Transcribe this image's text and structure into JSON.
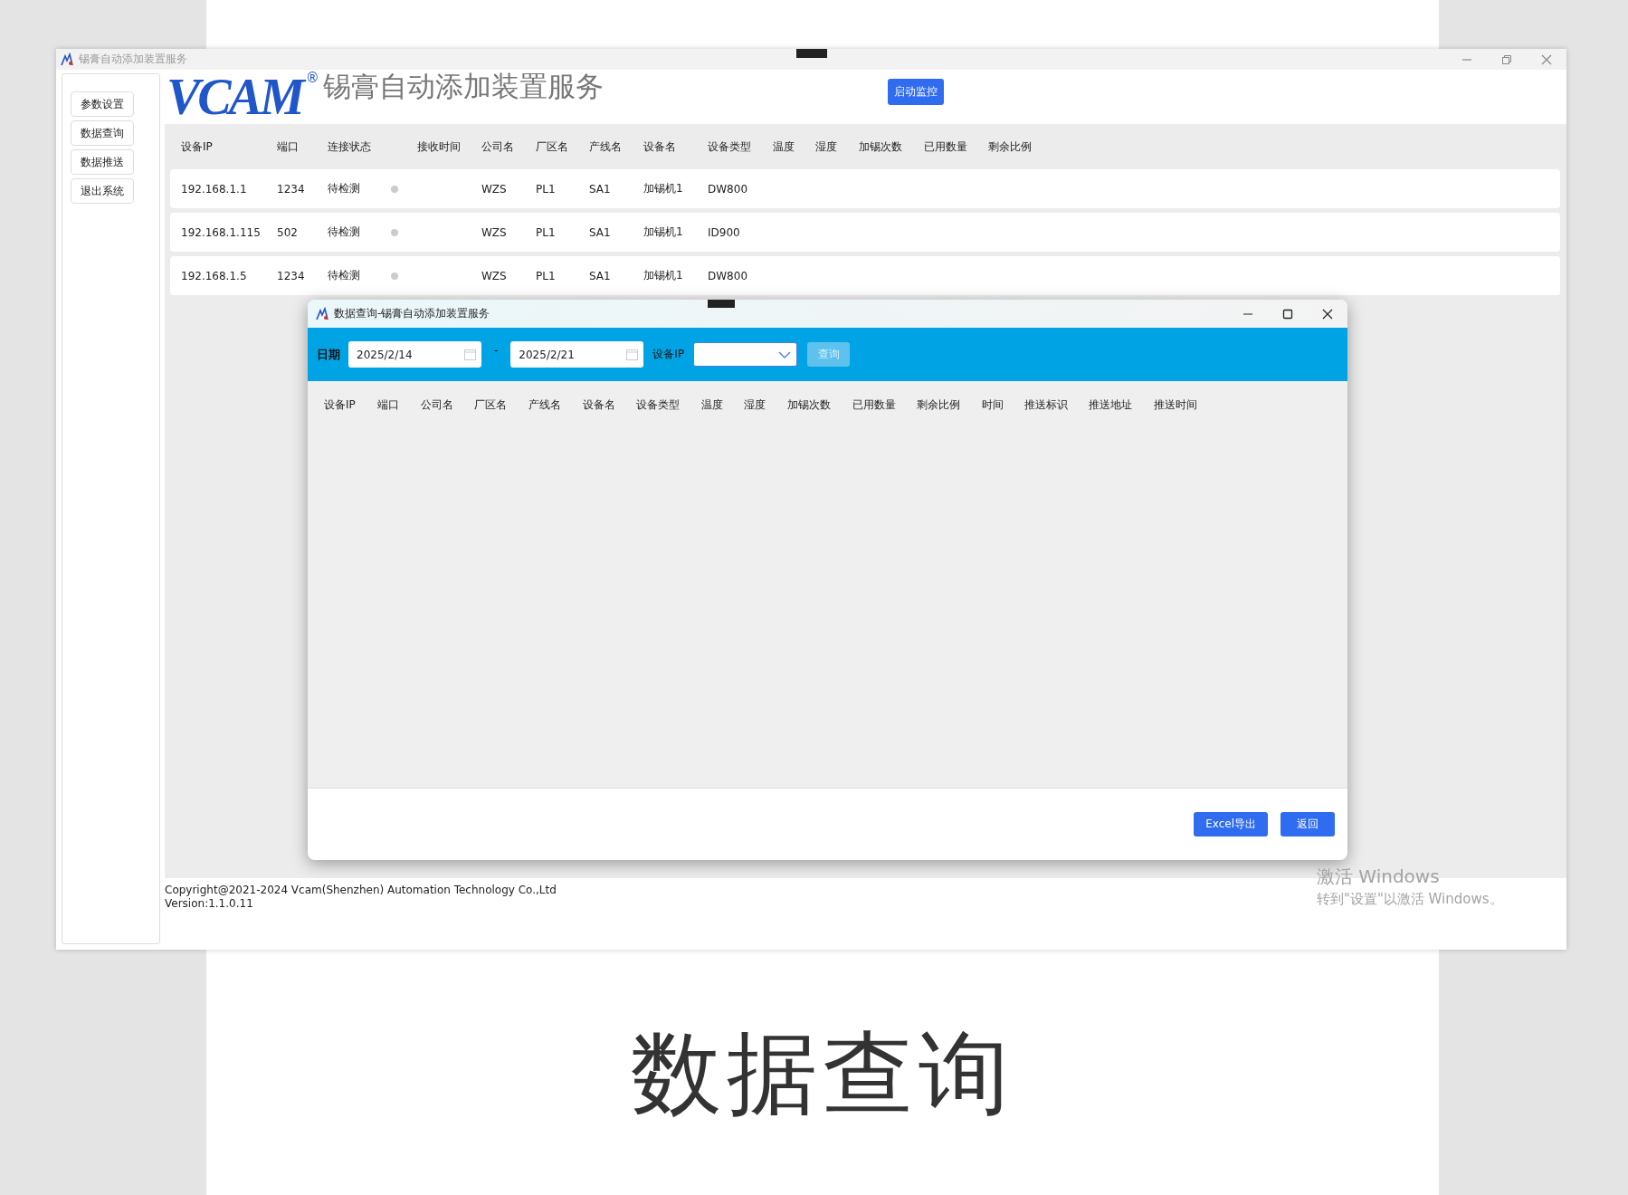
{
  "window": {
    "title": "锡膏自动添加装置服务"
  },
  "sidebar": {
    "items": [
      "参数设置",
      "数据查询",
      "数据推送",
      "退出系统"
    ]
  },
  "header": {
    "logo": "VCAM",
    "logo_mark": "®",
    "title": "锡膏自动添加装置服务",
    "monitor_button": "启动监控"
  },
  "table": {
    "columns": [
      "设备IP",
      "端口",
      "连接状态",
      "接收时间",
      "公司名",
      "厂区名",
      "产线名",
      "设备名",
      "设备类型",
      "温度",
      "湿度",
      "加锡次数",
      "已用数量",
      "剩余比例"
    ],
    "rows": [
      {
        "ip": "192.168.1.1",
        "port": "1234",
        "status": "待检测",
        "color": "#cccccc",
        "company": "WZS",
        "plant": "PL1",
        "line": "SA1",
        "device": "加锡机1",
        "type": "DW800"
      },
      {
        "ip": "192.168.1.115",
        "port": "502",
        "status": "待检测",
        "color": "#cccccc",
        "company": "WZS",
        "plant": "PL1",
        "line": "SA1",
        "device": "加锡机1",
        "type": "ID900"
      },
      {
        "ip": "192.168.1.5",
        "port": "1234",
        "status": "待检测",
        "color": "#cccccc",
        "company": "WZS",
        "plant": "PL1",
        "line": "SA1",
        "device": "加锡机1",
        "type": "DW800"
      }
    ]
  },
  "dialog": {
    "title": "数据查询-锡膏自动添加装置服务",
    "filter": {
      "date_label": "日期",
      "start_date": "2025/2/14",
      "separator": "-",
      "end_date": "2025/2/21",
      "ip_label": "设备IP",
      "query_button": {
        "label": "查询",
        "disabled": true
      }
    },
    "columns": [
      "设备IP",
      "端口",
      "公司名",
      "厂区名",
      "产线名",
      "设备名",
      "设备类型",
      "温度",
      "湿度",
      "加锡次数",
      "已用数量",
      "剩余比例",
      "时间",
      "推送标识",
      "推送地址",
      "推送时间"
    ],
    "buttons": [
      "Excel导出",
      "返回"
    ]
  },
  "footer": {
    "copyright": "Copyright@2021-2024 Vcam(Shenzhen) Automation Technology Co.,Ltd",
    "version": "Version:1.1.0.11"
  },
  "activation": {
    "title": "激活 Windows",
    "subtitle": "转到\"设置\"以激活 Windows。"
  },
  "caption": "数据查询"
}
